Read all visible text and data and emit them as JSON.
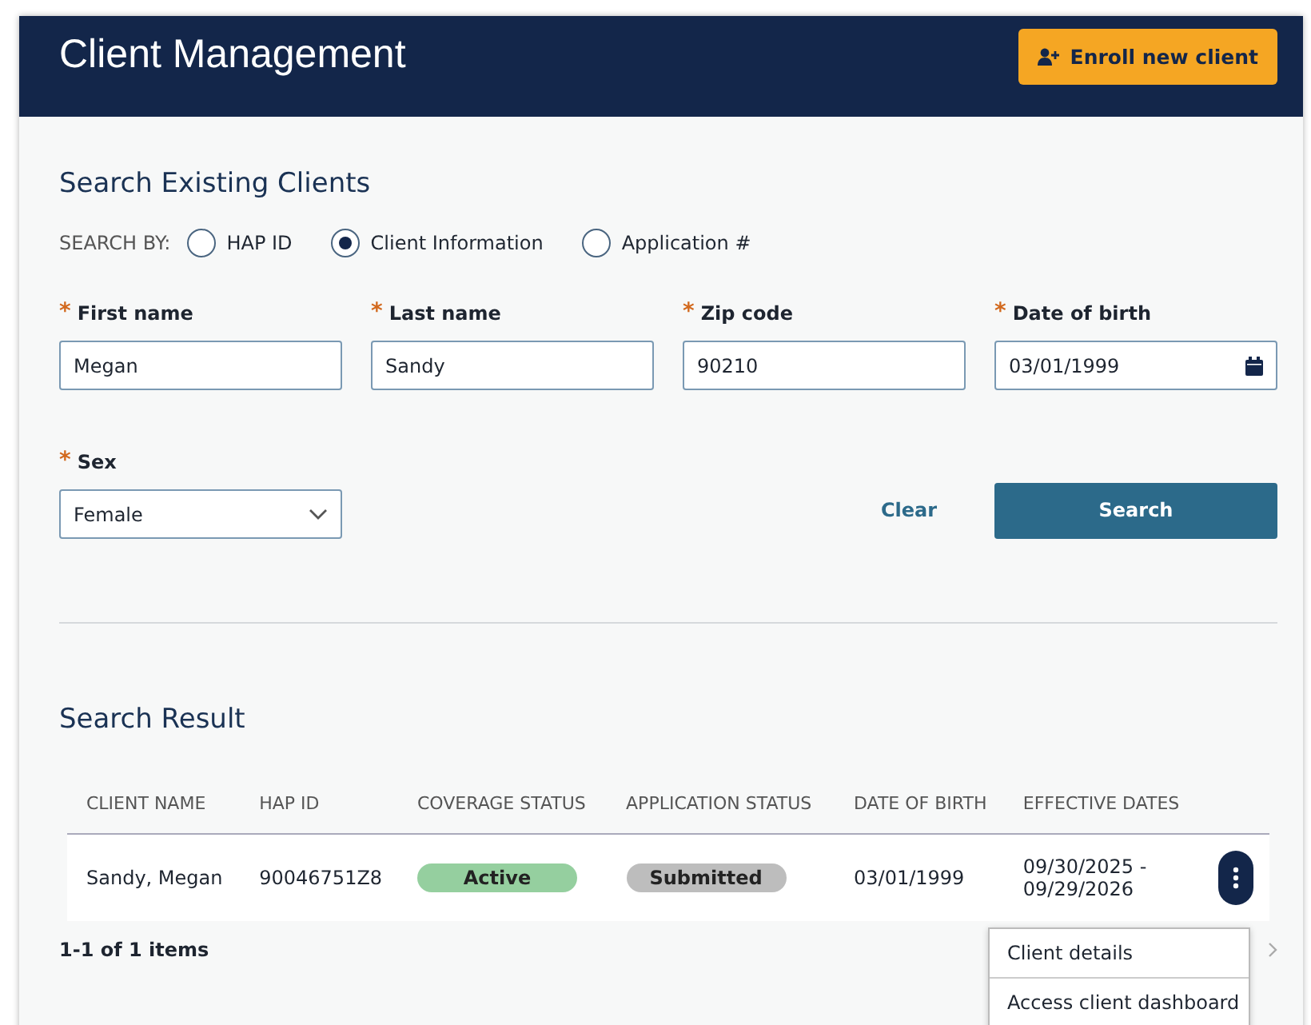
{
  "header": {
    "title": "Client Management",
    "enroll_button": "Enroll new client"
  },
  "search": {
    "title": "Search Existing Clients",
    "search_by_label": "SEARCH BY:",
    "options": [
      {
        "label": "HAP ID",
        "selected": false
      },
      {
        "label": "Client Information",
        "selected": true
      },
      {
        "label": "Application #",
        "selected": false
      }
    ],
    "fields": [
      {
        "required_mark": "*",
        "label": "First name",
        "value": "Megan",
        "kind": "text"
      },
      {
        "required_mark": "*",
        "label": "Last name",
        "value": "Sandy",
        "kind": "text"
      },
      {
        "required_mark": "*",
        "label": "Zip code",
        "value": "90210",
        "kind": "text"
      },
      {
        "required_mark": "*",
        "label": "Date of birth",
        "value": "03/01/1999",
        "kind": "date"
      },
      {
        "required_mark": "*",
        "label": "Sex",
        "value": "Female",
        "kind": "select"
      }
    ],
    "clear_button": "Clear",
    "search_button": "Search"
  },
  "results": {
    "title": "Search Result",
    "columns": [
      "CLIENT NAME",
      "HAP ID",
      "COVERAGE STATUS",
      "APPLICATION STATUS",
      "DATE OF BIRTH",
      "EFFECTIVE DATES"
    ],
    "rows": [
      {
        "client_name": "Sandy, Megan",
        "hap_id": "90046751Z8",
        "coverage_status": {
          "label": "Active",
          "color": "#95cf9f"
        },
        "application_status": {
          "label": "Submitted",
          "color": "#bdbdbd"
        },
        "date_of_birth": "03/01/1999",
        "effective_dates": [
          "09/30/2025 -",
          "09/29/2026"
        ]
      }
    ],
    "pagination": "1-1 of 1 items",
    "row_menu": [
      "Client details",
      "Access client dashboard"
    ]
  }
}
